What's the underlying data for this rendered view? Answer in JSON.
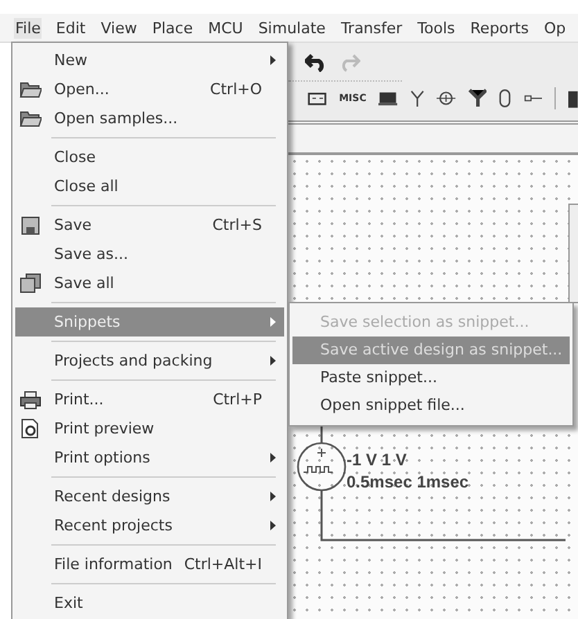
{
  "menu_bar": [
    {
      "label": "File",
      "selected": true
    },
    {
      "label": "Edit",
      "selected": false
    },
    {
      "label": "View",
      "selected": false
    },
    {
      "label": "Place",
      "selected": false
    },
    {
      "label": "MCU",
      "selected": false
    },
    {
      "label": "Simulate",
      "selected": false
    },
    {
      "label": "Transfer",
      "selected": false
    },
    {
      "label": "Tools",
      "selected": false
    },
    {
      "label": "Reports",
      "selected": false
    },
    {
      "label": "Op",
      "selected": false
    }
  ],
  "toolbar": {
    "misc_label": "MISC"
  },
  "file_menu": [
    {
      "kind": "item",
      "label": "New",
      "submenu": true,
      "selected": false
    },
    {
      "kind": "item",
      "label": "Open...",
      "shortcut": "Ctrl+O",
      "submenu": false,
      "selected": false
    },
    {
      "kind": "item",
      "label": "Open samples...",
      "submenu": false,
      "selected": false
    },
    {
      "kind": "separator"
    },
    {
      "kind": "item",
      "label": "Close",
      "submenu": false,
      "selected": false
    },
    {
      "kind": "item",
      "label": "Close all",
      "submenu": false,
      "selected": false
    },
    {
      "kind": "separator"
    },
    {
      "kind": "item",
      "label": "Save",
      "shortcut": "Ctrl+S",
      "submenu": false,
      "selected": false
    },
    {
      "kind": "item",
      "label": "Save as...",
      "submenu": false,
      "selected": false
    },
    {
      "kind": "item",
      "label": "Save all",
      "submenu": false,
      "selected": false
    },
    {
      "kind": "separator"
    },
    {
      "kind": "item",
      "label": "Snippets",
      "submenu": true,
      "selected": true
    },
    {
      "kind": "separator"
    },
    {
      "kind": "item",
      "label": "Projects and packing",
      "submenu": true,
      "selected": false
    },
    {
      "kind": "separator"
    },
    {
      "kind": "item",
      "label": "Print...",
      "shortcut": "Ctrl+P",
      "submenu": false,
      "selected": false
    },
    {
      "kind": "item",
      "label": "Print preview",
      "submenu": false,
      "selected": false
    },
    {
      "kind": "item",
      "label": "Print options",
      "submenu": true,
      "selected": false
    },
    {
      "kind": "separator"
    },
    {
      "kind": "item",
      "label": "Recent designs",
      "submenu": true,
      "selected": false
    },
    {
      "kind": "item",
      "label": "Recent projects",
      "submenu": true,
      "selected": false
    },
    {
      "kind": "separator"
    },
    {
      "kind": "item",
      "label": "File information",
      "shortcut": "Ctrl+Alt+I",
      "submenu": false,
      "selected": false
    },
    {
      "kind": "separator"
    },
    {
      "kind": "item",
      "label": "Exit",
      "submenu": false,
      "selected": false
    }
  ],
  "snippets_menu": [
    {
      "label": "Save selection as snippet...",
      "disabled": true,
      "selected": false
    },
    {
      "label": "Save active design as snippet...",
      "disabled": true,
      "selected": true
    },
    {
      "label": "Paste snippet...",
      "disabled": false,
      "selected": false
    },
    {
      "label": "Open snippet file...",
      "disabled": false,
      "selected": false
    }
  ],
  "circuit": {
    "amplitude": "-1 V 1 V",
    "timing": "0.5msec 1msec"
  }
}
